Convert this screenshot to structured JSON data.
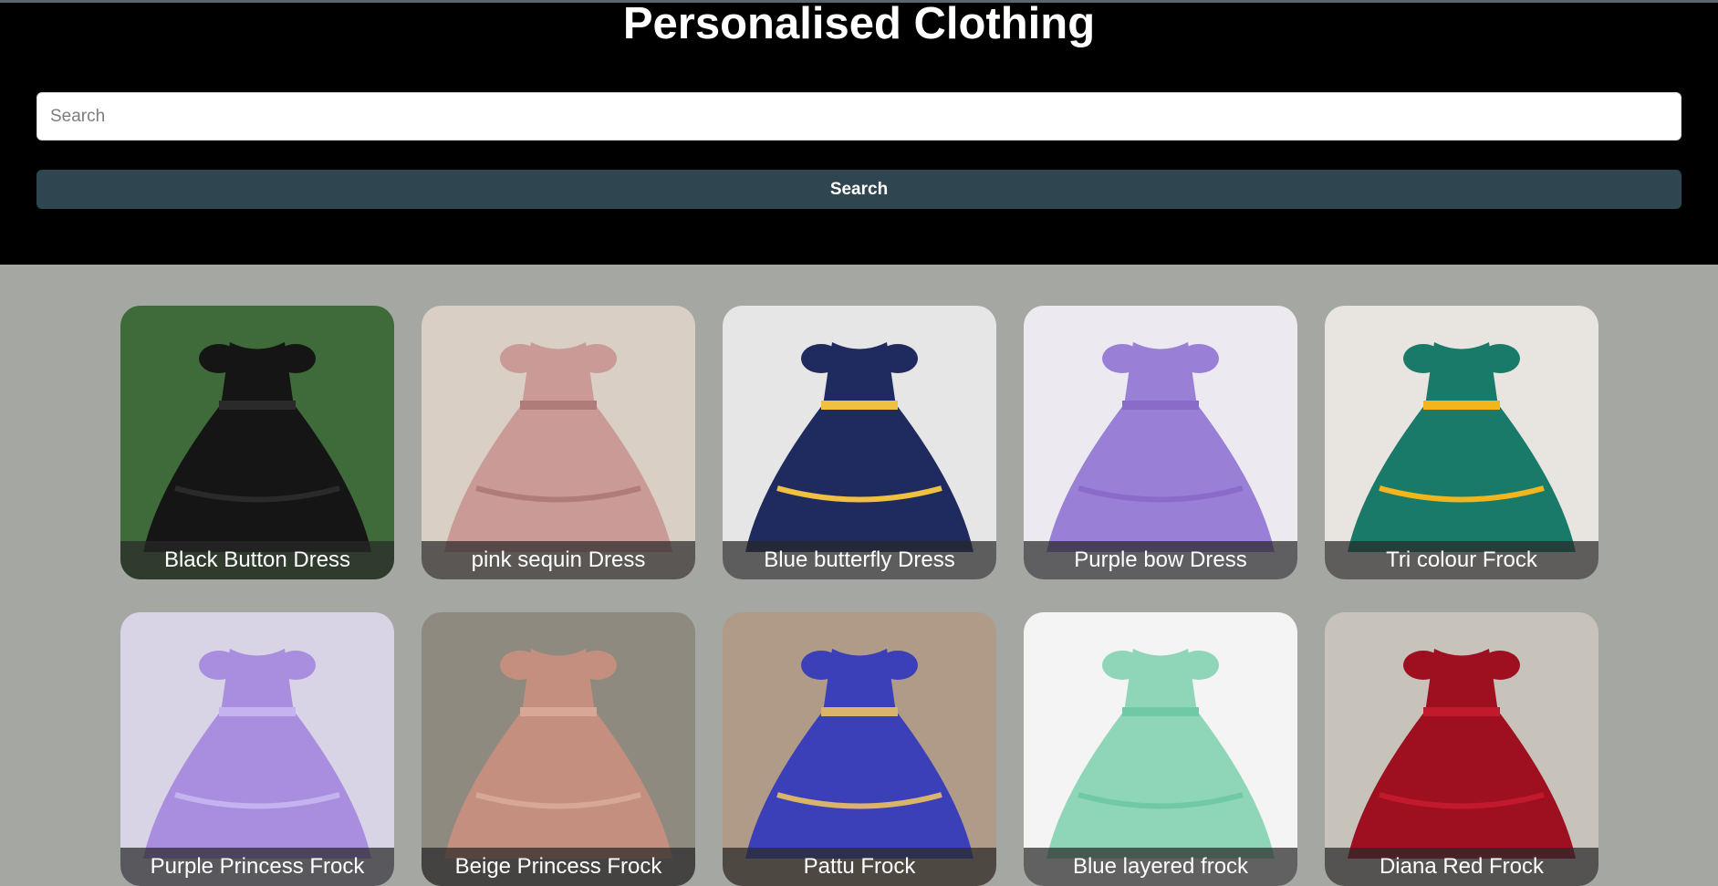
{
  "header": {
    "title": "Personalised Clothing",
    "search_placeholder": "Search",
    "search_value": "",
    "search_button_label": "Search"
  },
  "products": [
    {
      "name": "Black Button Dress",
      "bg": "#3f6b3a",
      "dress": "#151515",
      "accent": "#2a2a2a"
    },
    {
      "name": "pink sequin Dress",
      "bg": "#d9cfc4",
      "dress": "#c99a96",
      "accent": "#b07c7a"
    },
    {
      "name": "Blue butterfly Dress",
      "bg": "#e6e6e6",
      "dress": "#1f2a5e",
      "accent": "#f0c040"
    },
    {
      "name": "Purple bow Dress",
      "bg": "#eceaf0",
      "dress": "#9a7fd6",
      "accent": "#8a6bc9"
    },
    {
      "name": "Tri colour Frock",
      "bg": "#e8e4df",
      "dress": "#1a7a6a",
      "accent": "#f2b51c"
    },
    {
      "name": "Purple Princess Frock",
      "bg": "#d8d4e6",
      "dress": "#a98ee0",
      "accent": "#c4b3ee"
    },
    {
      "name": "Beige Princess Frock",
      "bg": "#8f8a80",
      "dress": "#c48f7e",
      "accent": "#d8a896"
    },
    {
      "name": "Pattu Frock",
      "bg": "#b09a88",
      "dress": "#3b3fb8",
      "accent": "#d9b46a"
    },
    {
      "name": "Blue layered frock",
      "bg": "#f4f4f4",
      "dress": "#8fd6b8",
      "accent": "#6fc9a4"
    },
    {
      "name": "Diana Red Frock",
      "bg": "#c7c3bb",
      "dress": "#9e1020",
      "accent": "#c21a2c"
    }
  ]
}
